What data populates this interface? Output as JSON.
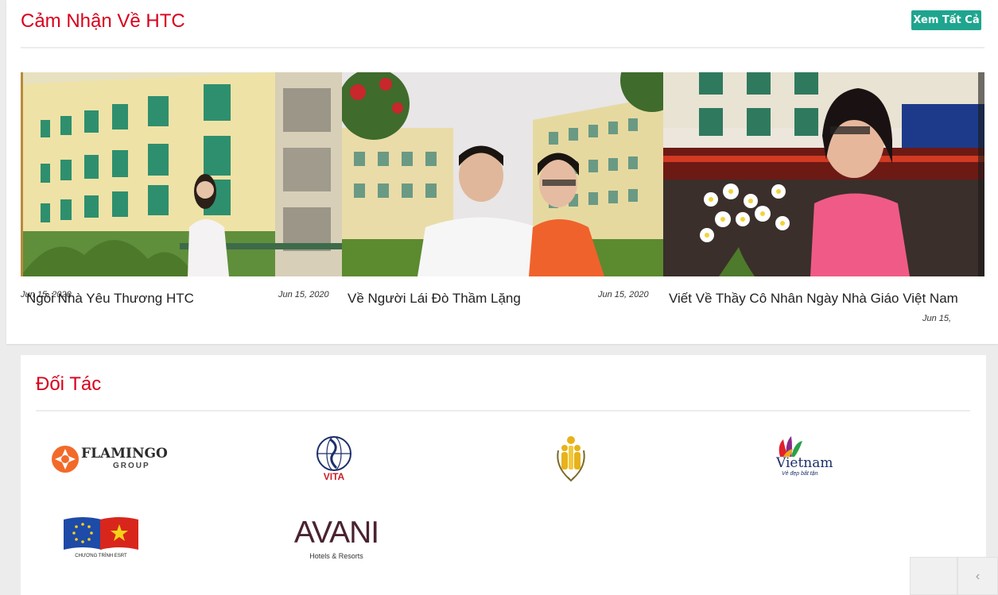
{
  "testimonials": {
    "title": "Cảm Nhận Về HTC",
    "view_all_label": "Xem Tất Cả",
    "slides": [
      {
        "title": "",
        "date": "Jun 15, 2020",
        "date_visible": "2020",
        "image": "bay-view-photo"
      },
      {
        "title": "Ngôi Nhà Yêu Thương HTC",
        "date": "Jun 15, 2020",
        "image": "yellow-building-girl-photo"
      },
      {
        "title": "Về Người Lái Đò Thầm Lặng",
        "date": "Jun 15, 2020",
        "image": "teachers-campus-photo"
      },
      {
        "title": "Viết Về Thầy Cô Nhân Ngày Nhà Giáo Việt Nam",
        "date": "Jun 15,",
        "image": "teacher-flowers-photo"
      }
    ]
  },
  "partners": {
    "title": "Đối Tác",
    "logos": [
      {
        "name": "flamingo-logo",
        "text": "FLAMINGO",
        "subtext": "GROUP"
      },
      {
        "name": "vita-logo",
        "text": "VITA"
      },
      {
        "name": "union-logo",
        "text": ""
      },
      {
        "name": "vietnam-tourism-logo",
        "text": "Vietnam",
        "subtext": "Vẻ đẹp bất tận"
      },
      {
        "name": "esrt-logo",
        "text": "CHƯƠNG TRÌNH ESRT"
      },
      {
        "name": "avani-logo",
        "text": "AVANI",
        "subtext": "Hotels & Resorts"
      }
    ]
  },
  "nav": {
    "prev_icon": "chevron-left-icon",
    "prev_symbol": "‹"
  },
  "colors": {
    "title_red": "#d9001b",
    "button_teal": "#1fa58f"
  }
}
